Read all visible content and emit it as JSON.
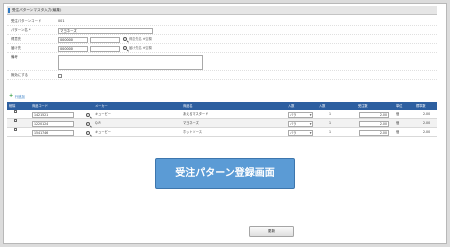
{
  "title": "受注パターンマスタ入力(編集)",
  "form": {
    "pattern_code_label": "受注パターンコード",
    "pattern_code_value": "001",
    "pattern_name_label": "パターン名 *",
    "pattern_name_value": "マヨネーズ",
    "customer_label": "得意先",
    "customer_code": "000000",
    "customer_hint": "得意先名 ※空欄",
    "delivery_label": "届け先",
    "delivery_code": "000000",
    "delivery_hint": "届け先名 ※空欄",
    "remarks_label": "備考",
    "remarks_value": "",
    "disable_label": "無効にする"
  },
  "add_row_label": "行追加",
  "table": {
    "headers": [
      "削除",
      "商品コード",
      "メーカー",
      "商品名",
      "入数",
      "入数",
      "受注数",
      "単位",
      "標準数"
    ],
    "rows": [
      {
        "code": "1421521",
        "maker": "キューピー",
        "name": "あえるマスタード",
        "unit_select": "バラ",
        "irisu": "1",
        "qty": "2.00",
        "unit": "個",
        "std": "2.00"
      },
      {
        "code": "1220124",
        "maker": "Q.P.",
        "name": "マヨネーズ",
        "unit_select": "バラ",
        "irisu": "1",
        "qty": "2.00",
        "unit": "個",
        "std": "2.00"
      },
      {
        "code": "1541746",
        "maker": "キューピー",
        "name": "ホットソース",
        "unit_select": "バラ",
        "irisu": "1",
        "qty": "2.00",
        "unit": "個",
        "std": "2.00"
      }
    ]
  },
  "banner_text": "受注パターン登録画面",
  "update_button": "更新"
}
